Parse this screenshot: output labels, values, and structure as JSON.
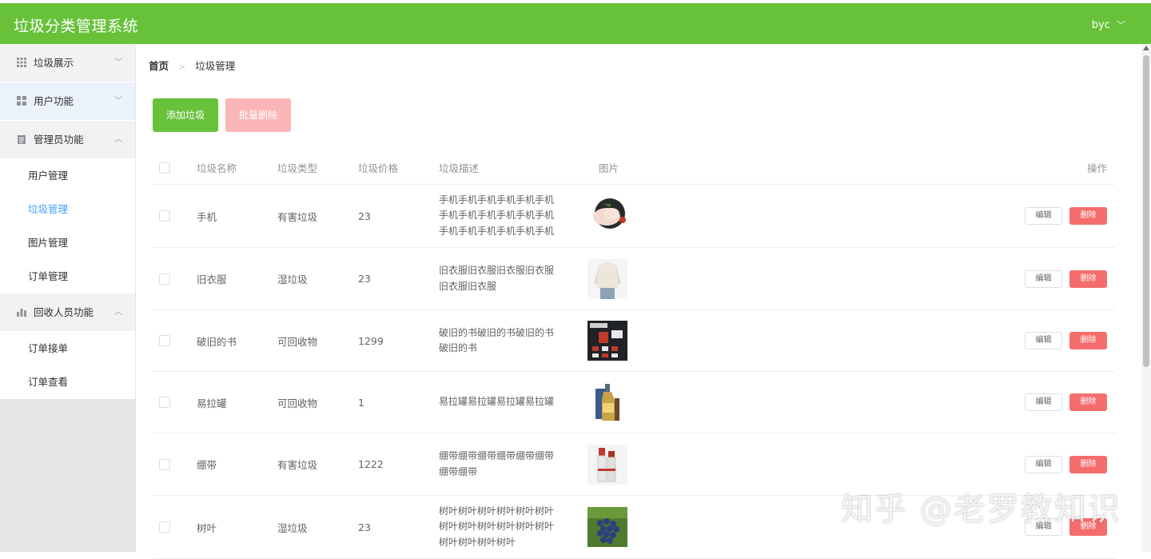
{
  "header": {
    "title": "垃圾分类管理系统",
    "user": "byc"
  },
  "sidebar": {
    "groups": [
      {
        "label": "垃圾展示",
        "items": []
      },
      {
        "label": "用户功能",
        "items": []
      },
      {
        "label": "管理员功能",
        "items": [
          "用户管理",
          "垃圾管理",
          "图片管理",
          "订单管理"
        ]
      },
      {
        "label": "回收人员功能",
        "items": [
          "订单接单",
          "订单查看"
        ]
      }
    ],
    "selected": "垃圾管理"
  },
  "breadcrumb": {
    "home": "首页",
    "current": "垃圾管理"
  },
  "toolbar": {
    "add_label": "添加垃圾",
    "batch_delete_label": "批量删除"
  },
  "table": {
    "headers": {
      "name": "垃圾名称",
      "type": "垃圾类型",
      "price": "垃圾价格",
      "desc": "垃圾描述",
      "image": "图片",
      "op": "操作"
    },
    "edit_label": "编辑",
    "delete_label": "删除",
    "rows": [
      {
        "name": "手机",
        "type": "有害垃圾",
        "price": "23",
        "desc": "手机手机手机手机手机手机手机手机手机手机手机手机手机手机手机手机手机手机",
        "image": "chicken"
      },
      {
        "name": "旧衣服",
        "type": "湿垃圾",
        "price": "23",
        "desc": "旧衣服旧衣服旧衣服旧衣服旧衣服旧衣服",
        "image": "clothes"
      },
      {
        "name": "破旧的书",
        "type": "可回收物",
        "price": "1299",
        "desc": "破旧的书破旧的书破旧的书破旧的书",
        "image": "book"
      },
      {
        "name": "易拉罐",
        "type": "可回收物",
        "price": "1",
        "desc": "易拉罐易拉罐易拉罐易拉罐",
        "image": "bottle"
      },
      {
        "name": "绷带",
        "type": "有害垃圾",
        "price": "1222",
        "desc": "绷带绷带绷带绷带绷带绷带绷带绷带",
        "image": "lipstick"
      },
      {
        "name": "树叶",
        "type": "湿垃圾",
        "price": "23",
        "desc": "树叶树叶树叶树叶树叶树叶树叶树叶树叶树叶树叶树叶树叶树叶树叶树叶",
        "image": "grapes"
      }
    ]
  },
  "watermark": "知乎 @老罗教知识",
  "colors": {
    "primary": "#67c23a",
    "danger": "#f56c6c",
    "danger_light": "#fab6b6",
    "link": "#409eff"
  }
}
